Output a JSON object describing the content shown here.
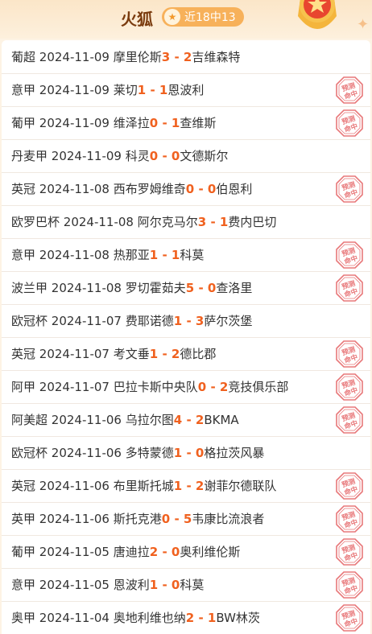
{
  "header": {
    "title": "火狐",
    "badge_text": "近18中13",
    "badge_icon": "star-icon"
  },
  "stamp_text": [
    "预测",
    "命中"
  ],
  "matches": [
    {
      "league": "葡超",
      "date": "2024-11-09",
      "home": "摩里伦斯",
      "home_score": "3",
      "sep": " - ",
      "away_score": "2",
      "away": "吉维森特",
      "hit": false
    },
    {
      "league": "意甲",
      "date": "2024-11-09",
      "home": "莱切",
      "home_score": "1",
      "sep": " - ",
      "away_score": "1",
      "away": "恩波利",
      "hit": true
    },
    {
      "league": "葡甲",
      "date": "2024-11-09",
      "home": "维泽拉",
      "home_score": "0",
      "sep": " - ",
      "away_score": "1",
      "away": "查维斯",
      "hit": true
    },
    {
      "league": "丹麦甲",
      "date": "2024-11-09",
      "home": "科灵",
      "home_score": "0",
      "sep": " - ",
      "away_score": "0",
      "away": "文德斯尔",
      "hit": false
    },
    {
      "league": "英冠",
      "date": "2024-11-08",
      "home": "西布罗姆维奇",
      "home_score": "0",
      "sep": " - ",
      "away_score": "0",
      "away": "伯恩利",
      "hit": true
    },
    {
      "league": "欧罗巴杯",
      "date": "2024-11-08",
      "home": "阿尔克马尔",
      "home_score": "3",
      "sep": " - ",
      "away_score": "1",
      "away": "费内巴切",
      "hit": false
    },
    {
      "league": "意甲",
      "date": "2024-11-08",
      "home": "热那亚",
      "home_score": "1",
      "sep": " - ",
      "away_score": "1",
      "away": "科莫",
      "hit": true
    },
    {
      "league": "波兰甲",
      "date": "2024-11-08",
      "home": "罗切霍茹夫",
      "home_score": "5",
      "sep": " - ",
      "away_score": "0",
      "away": "查洛里",
      "hit": true
    },
    {
      "league": "欧冠杯",
      "date": "2024-11-07",
      "home": "费耶诺德",
      "home_score": "1",
      "sep": " - ",
      "away_score": "3",
      "away": "萨尔茨堡",
      "hit": false
    },
    {
      "league": "英冠",
      "date": "2024-11-07",
      "home": "考文垂",
      "home_score": "1",
      "sep": " - ",
      "away_score": "2",
      "away": "德比郡",
      "hit": true
    },
    {
      "league": "阿甲",
      "date": "2024-11-07",
      "home": "巴拉卡斯中央队",
      "home_score": "0",
      "sep": " - ",
      "away_score": "2",
      "away": "竞技俱乐部",
      "hit": true
    },
    {
      "league": "阿美超",
      "date": "2024-11-06",
      "home": "乌拉尔图",
      "home_score": "4",
      "sep": " - ",
      "away_score": "2",
      "away": "BKMA",
      "hit": true
    },
    {
      "league": "欧冠杯",
      "date": "2024-11-06",
      "home": "多特蒙德",
      "home_score": "1",
      "sep": " - ",
      "away_score": "0",
      "away": "格拉茨风暴",
      "hit": false
    },
    {
      "league": "英冠",
      "date": "2024-11-06",
      "home": "布里斯托城",
      "home_score": "1",
      "sep": " - ",
      "away_score": "2",
      "away": "谢菲尔德联队",
      "hit": true
    },
    {
      "league": "英甲",
      "date": "2024-11-06",
      "home": "斯托克港",
      "home_score": "0",
      "sep": " - ",
      "away_score": "5",
      "away": "韦康比流浪者",
      "hit": true
    },
    {
      "league": "葡甲",
      "date": "2024-11-05",
      "home": "唐迪拉",
      "home_score": "2",
      "sep": " - ",
      "away_score": "0",
      "away": "奥利维伦斯",
      "hit": true
    },
    {
      "league": "意甲",
      "date": "2024-11-05",
      "home": "恩波利",
      "home_score": "1",
      "sep": " - ",
      "away_score": "0",
      "away": "科莫",
      "hit": true
    },
    {
      "league": "奥甲",
      "date": "2024-11-04",
      "home": "奥地利维也纳",
      "home_score": "2",
      "sep": " - ",
      "away_score": "1",
      "away": "BW林茨",
      "hit": true
    }
  ],
  "colors": {
    "score": "#f0611f",
    "stamp": "#e8787a",
    "badge": "#f7b15a",
    "title": "#7a3b0e"
  }
}
